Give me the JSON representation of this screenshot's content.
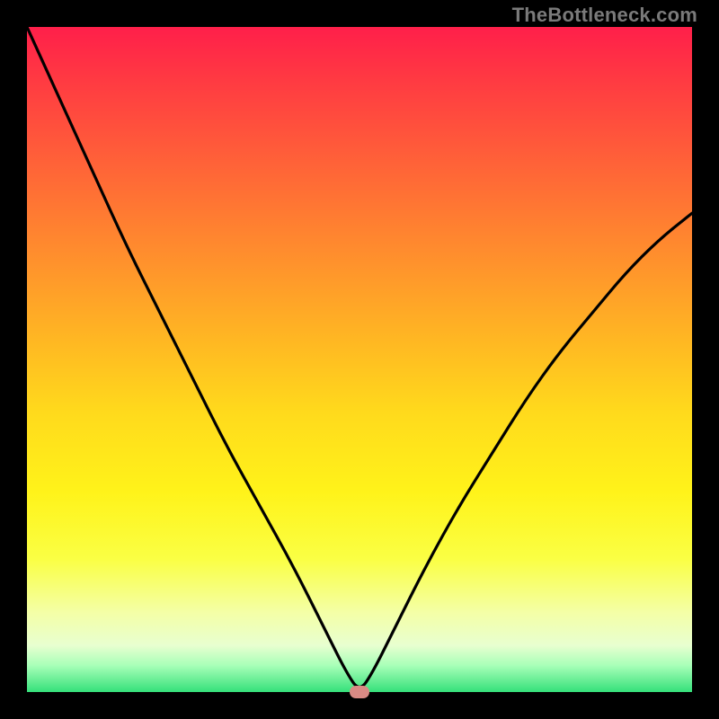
{
  "watermark": "TheBottleneck.com",
  "chart_data": {
    "type": "line",
    "title": "",
    "xlabel": "",
    "ylabel": "",
    "xlim": [
      0,
      100
    ],
    "ylim": [
      0,
      100
    ],
    "x": [
      0,
      5,
      10,
      15,
      20,
      25,
      30,
      35,
      40,
      45,
      48,
      50,
      52,
      55,
      60,
      65,
      70,
      75,
      80,
      85,
      90,
      95,
      100
    ],
    "y": [
      100,
      89,
      78,
      67,
      57,
      47,
      37,
      28,
      19,
      9,
      3,
      0,
      3,
      9,
      19,
      28,
      36,
      44,
      51,
      57,
      63,
      68,
      72
    ],
    "marker": {
      "x": 50,
      "y": 0
    },
    "background_gradient": {
      "top": "#ff1f4a",
      "mid": "#ffee1a",
      "bottom": "#35e07a"
    }
  }
}
